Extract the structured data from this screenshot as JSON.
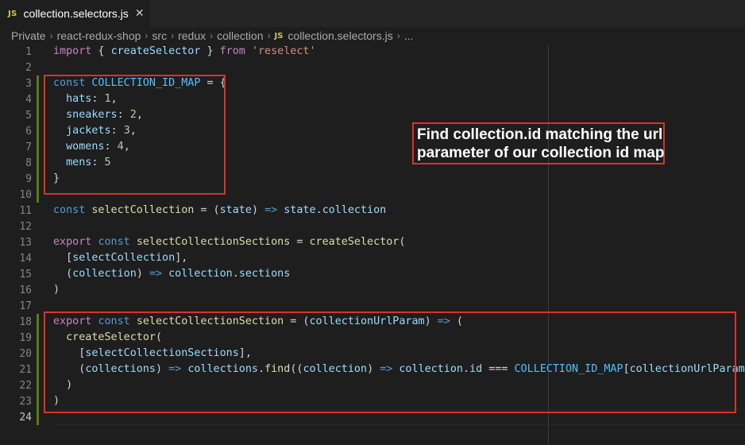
{
  "tab": {
    "badge": "JS",
    "filename": "collection.selectors.js",
    "close_glyph": "✕"
  },
  "breadcrumb": {
    "items": [
      "Private",
      "react-redux-shop",
      "src",
      "redux",
      "collection"
    ],
    "file_badge": "JS",
    "file": "collection.selectors.js",
    "trailing": "...",
    "separator": "›"
  },
  "gutter": [
    "1",
    "2",
    "3",
    "4",
    "5",
    "6",
    "7",
    "8",
    "9",
    "10",
    "11",
    "12",
    "13",
    "14",
    "15",
    "16",
    "17",
    "18",
    "19",
    "20",
    "21",
    "22",
    "23",
    "24"
  ],
  "active_line": "24",
  "annotation": {
    "line1": "Find collection.id matching the url",
    "line2": "parameter of our collection id map"
  },
  "code": [
    [
      [
        "import",
        "k-imp"
      ],
      [
        " { ",
        "pun"
      ],
      [
        "createSelector",
        "var"
      ],
      [
        " } ",
        "pun"
      ],
      [
        "from",
        "k-imp"
      ],
      [
        " ",
        "pun"
      ],
      [
        "'reselect'",
        "str"
      ]
    ],
    [],
    [
      [
        "const",
        "k-decl"
      ],
      [
        " ",
        "pun"
      ],
      [
        "COLLECTION_ID_MAP",
        "const"
      ],
      [
        " = {",
        "pun"
      ]
    ],
    [
      [
        "  ",
        "pun"
      ],
      [
        "hats",
        "var"
      ],
      [
        ": ",
        "pun"
      ],
      [
        "1",
        "num"
      ],
      [
        ",",
        "pun"
      ]
    ],
    [
      [
        "  ",
        "pun"
      ],
      [
        "sneakers",
        "var"
      ],
      [
        ": ",
        "pun"
      ],
      [
        "2",
        "num"
      ],
      [
        ",",
        "pun"
      ]
    ],
    [
      [
        "  ",
        "pun"
      ],
      [
        "jackets",
        "var"
      ],
      [
        ": ",
        "pun"
      ],
      [
        "3",
        "num"
      ],
      [
        ",",
        "pun"
      ]
    ],
    [
      [
        "  ",
        "pun"
      ],
      [
        "womens",
        "var"
      ],
      [
        ": ",
        "pun"
      ],
      [
        "4",
        "num"
      ],
      [
        ",",
        "pun"
      ]
    ],
    [
      [
        "  ",
        "pun"
      ],
      [
        "mens",
        "var"
      ],
      [
        ": ",
        "pun"
      ],
      [
        "5",
        "num"
      ]
    ],
    [
      [
        "}",
        "pun"
      ]
    ],
    [],
    [
      [
        "const",
        "k-decl"
      ],
      [
        " ",
        "pun"
      ],
      [
        "selectCollection",
        "fn"
      ],
      [
        " = (",
        "pun"
      ],
      [
        "state",
        "var"
      ],
      [
        ") ",
        "pun"
      ],
      [
        "=>",
        "k-decl"
      ],
      [
        " ",
        "pun"
      ],
      [
        "state",
        "var"
      ],
      [
        ".",
        "pun"
      ],
      [
        "collection",
        "var"
      ]
    ],
    [],
    [
      [
        "export",
        "k-imp"
      ],
      [
        " ",
        "pun"
      ],
      [
        "const",
        "k-decl"
      ],
      [
        " ",
        "pun"
      ],
      [
        "selectCollectionSections",
        "fn"
      ],
      [
        " = ",
        "pun"
      ],
      [
        "createSelector",
        "fn"
      ],
      [
        "(",
        "pun"
      ]
    ],
    [
      [
        "  [",
        "pun"
      ],
      [
        "selectCollection",
        "var"
      ],
      [
        "],",
        "pun"
      ]
    ],
    [
      [
        "  (",
        "pun"
      ],
      [
        "collection",
        "var"
      ],
      [
        ") ",
        "pun"
      ],
      [
        "=>",
        "k-decl"
      ],
      [
        " ",
        "pun"
      ],
      [
        "collection",
        "var"
      ],
      [
        ".",
        "pun"
      ],
      [
        "sections",
        "var"
      ]
    ],
    [
      [
        ")",
        "pun"
      ]
    ],
    [],
    [
      [
        "export",
        "k-imp"
      ],
      [
        " ",
        "pun"
      ],
      [
        "const",
        "k-decl"
      ],
      [
        " ",
        "pun"
      ],
      [
        "selectCollectionSection",
        "fn"
      ],
      [
        " = (",
        "pun"
      ],
      [
        "collectionUrlParam",
        "var"
      ],
      [
        ") ",
        "pun"
      ],
      [
        "=>",
        "k-decl"
      ],
      [
        " (",
        "pun"
      ]
    ],
    [
      [
        "  ",
        "pun"
      ],
      [
        "createSelector",
        "fn"
      ],
      [
        "(",
        "pun"
      ]
    ],
    [
      [
        "    [",
        "pun"
      ],
      [
        "selectCollectionSections",
        "var"
      ],
      [
        "],",
        "pun"
      ]
    ],
    [
      [
        "    (",
        "pun"
      ],
      [
        "collections",
        "var"
      ],
      [
        ") ",
        "pun"
      ],
      [
        "=>",
        "k-decl"
      ],
      [
        " ",
        "pun"
      ],
      [
        "collections",
        "var"
      ],
      [
        ".",
        "pun"
      ],
      [
        "find",
        "fn"
      ],
      [
        "((",
        "pun"
      ],
      [
        "collection",
        "var"
      ],
      [
        ") ",
        "pun"
      ],
      [
        "=>",
        "k-decl"
      ],
      [
        " ",
        "pun"
      ],
      [
        "collection",
        "var"
      ],
      [
        ".",
        "pun"
      ],
      [
        "id",
        "var"
      ],
      [
        " === ",
        "pun"
      ],
      [
        "COLLECTION_ID_MAP",
        "const"
      ],
      [
        "[",
        "pun"
      ],
      [
        "collectionUrlParam",
        "var"
      ],
      [
        "])",
        "pun"
      ]
    ],
    [
      [
        "  )",
        "pun"
      ]
    ],
    [
      [
        ")",
        "pun"
      ]
    ],
    []
  ]
}
